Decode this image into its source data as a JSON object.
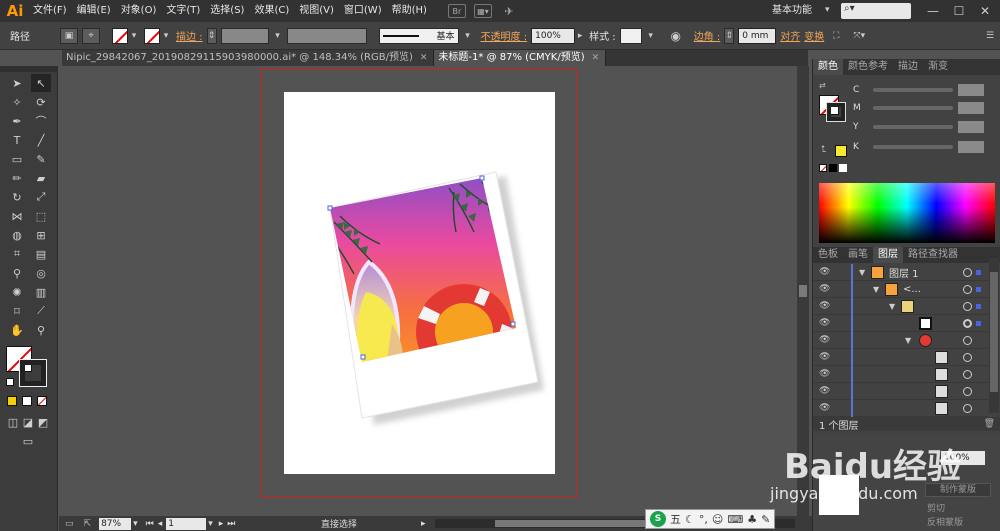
{
  "app": {
    "logo": "Ai",
    "workspace": "基本功能",
    "search_placeholder": ""
  },
  "menu": [
    "文件(F)",
    "编辑(E)",
    "对象(O)",
    "文字(T)",
    "选择(S)",
    "效果(C)",
    "视图(V)",
    "窗口(W)",
    "帮助(H)"
  ],
  "menu_icons": [
    "Br",
    "arrange-documents-icon",
    "gpu-performance-icon"
  ],
  "control": {
    "label": "路径",
    "stroke_label": "描边 :",
    "stroke_style": "基本",
    "opacity_label": "不透明度 :",
    "opacity_value": "100%",
    "style_label": "样式 :",
    "corner_label": "边角 :",
    "corner_value": "0 mm",
    "align_label": "对齐",
    "transform_label": "变换"
  },
  "tabs": [
    {
      "label": "Nipic_29842067_20190829115903980000.ai* @ 148.34% (RGB/预览)",
      "active": false
    },
    {
      "label": "未标题-1* @ 87% (CMYK/预览)",
      "active": true
    }
  ],
  "color_panel": {
    "tabs": [
      "颜色",
      "颜色参考",
      "描边",
      "渐变"
    ],
    "channels": [
      "C",
      "M",
      "Y",
      "K"
    ]
  },
  "layers_panel": {
    "tabs": [
      "色板",
      "画笔",
      "图层",
      "路径查找器"
    ],
    "layer1": "图层 1",
    "group": "<...",
    "footer": "1 个图层"
  },
  "bottom_panel": {
    "opacity_value": "100%",
    "make_mask": "制作蒙版",
    "clip": "剪切",
    "invert": "反相蒙版"
  },
  "status": {
    "zoom": "87%",
    "page": "1",
    "tool": "直接选择"
  },
  "ime": {
    "logo": "S",
    "label": "五"
  },
  "watermark": {
    "text": "Baidu经验",
    "url": "jingyan.baidu.com"
  },
  "colors": {
    "accent": "#f2a65a",
    "artboard_border": "#d32020",
    "selection": "#4a63e0"
  }
}
